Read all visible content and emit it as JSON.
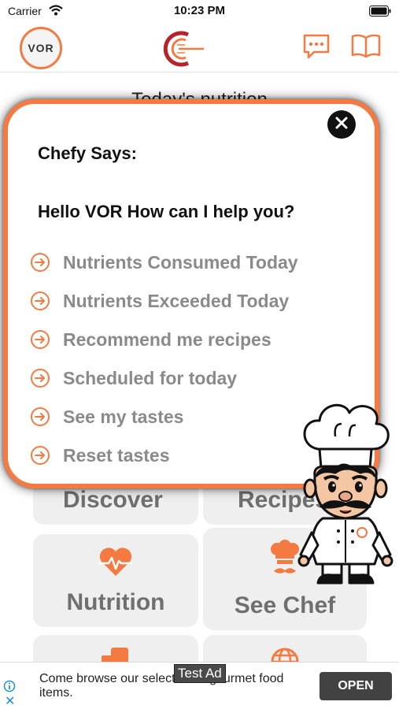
{
  "status_bar": {
    "carrier": "Carrier",
    "time": "10:23 PM"
  },
  "header": {
    "avatar_initials": "VOR",
    "icons": [
      "chefy-logo-icon",
      "chat-icon",
      "book-icon"
    ]
  },
  "dashboard": {
    "heading": "Today's nutrition",
    "tiles": {
      "discover": "Discover",
      "recipes": "Recipes",
      "nutrition": "Nutrition",
      "see_chef": "See Chef"
    }
  },
  "dialog": {
    "title": "Chefy Says:",
    "greeting": "Hello VOR How can I help you?",
    "options": [
      "Nutrients Consumed Today",
      "Nutrients Exceeded Today",
      "Recommend me recipes",
      "Scheduled for today",
      "See my tastes",
      "Reset tastes"
    ]
  },
  "ad": {
    "text": "Come browse our selection of gourmet food items.",
    "tag": "Test Ad",
    "open_label": "OPEN"
  },
  "colors": {
    "accent": "#f47a42",
    "option_text": "#8a8a8a",
    "tile_bg": "#efefef"
  }
}
